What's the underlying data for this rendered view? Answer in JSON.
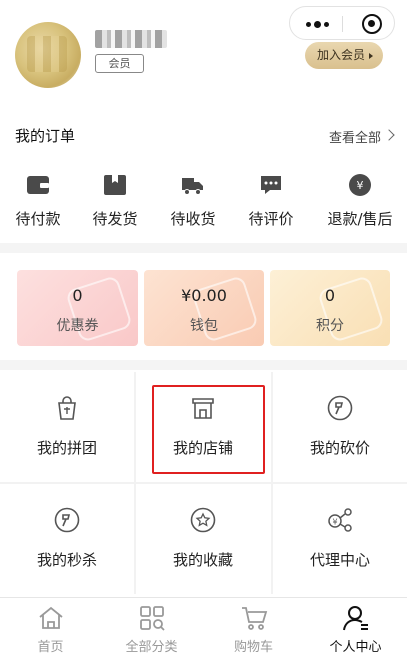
{
  "profile": {
    "member_label": "会员",
    "join_button": "加入会员"
  },
  "orders": {
    "title": "我的订单",
    "view_all": "查看全部",
    "items": [
      {
        "label": "待付款",
        "icon": "wallet-icon"
      },
      {
        "label": "待发货",
        "icon": "package-icon"
      },
      {
        "label": "待收货",
        "icon": "truck-icon"
      },
      {
        "label": "待评价",
        "icon": "comment-icon"
      },
      {
        "label": "退款/售后",
        "icon": "refund-icon"
      }
    ]
  },
  "wallet": [
    {
      "value": "0",
      "label": "优惠券",
      "color": "#fbd3d3"
    },
    {
      "value": "¥0.00",
      "label": "钱包",
      "color": "#fbd9c4"
    },
    {
      "value": "0",
      "label": "积分",
      "color": "#fbe5c2"
    }
  ],
  "services": [
    {
      "label": "我的拼团",
      "icon": "group-buy-icon"
    },
    {
      "label": "我的店铺",
      "icon": "store-icon"
    },
    {
      "label": "我的砍价",
      "icon": "bargain-icon"
    },
    {
      "label": "我的秒杀",
      "icon": "flash-sale-icon"
    },
    {
      "label": "我的收藏",
      "icon": "favorite-icon"
    },
    {
      "label": "代理中心",
      "icon": "agent-icon"
    }
  ],
  "tabbar": [
    {
      "label": "首页",
      "icon": "home-icon"
    },
    {
      "label": "全部分类",
      "icon": "category-icon"
    },
    {
      "label": "购物车",
      "icon": "cart-icon"
    },
    {
      "label": "个人中心",
      "icon": "profile-icon",
      "active": true
    }
  ],
  "colors": {
    "highlight": "#e02020",
    "accent_gold": "#d9c08e"
  }
}
